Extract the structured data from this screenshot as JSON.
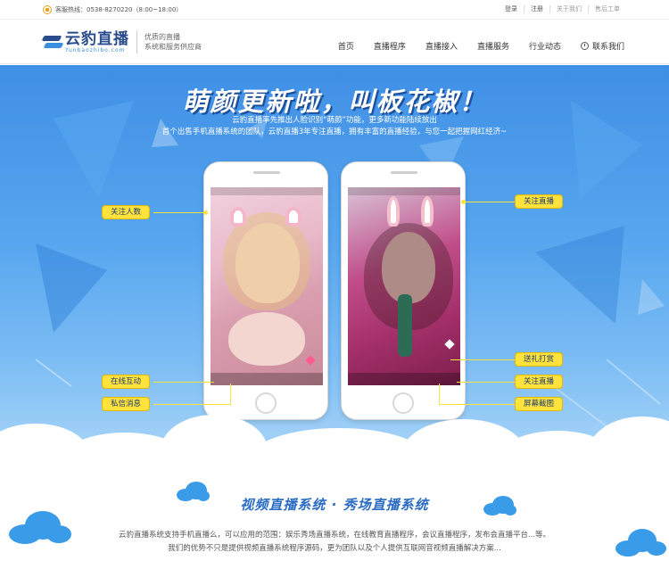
{
  "topbar": {
    "hotline": "客服热线：0538-8270220（8:00~18:00）",
    "links": [
      "登录",
      "注册",
      "关于我们",
      "售后工单"
    ]
  },
  "header": {
    "logo_cn": "云豹直播",
    "logo_en": "Yunbaozhibo.com",
    "slogan_line1": "优质的直播",
    "slogan_line2": "系统和服务供应商",
    "nav": [
      "首页",
      "直播程序",
      "直播接入",
      "直播服务",
      "行业动态"
    ],
    "contact": "联系我们"
  },
  "hero": {
    "headline": "萌颜更新啦，叫板花椒！",
    "intro_line1": "云豹直播率先推出人脸识别“萌颜”功能，更多新功能陆续放出",
    "intro_line2": "首个出售手机直播系统的团队，云豹直播3年专注直播，拥有丰富的直播经验，与您一起把握网红经济~",
    "callouts_left": [
      "关注人数",
      "在线互动",
      "私信消息"
    ],
    "callouts_right": [
      "关注直播",
      "送礼打赏",
      "关注直播",
      "屏幕截图"
    ]
  },
  "section": {
    "title": "视频直播系统 · 秀场直播系统",
    "body_line1": "云豹直播系统支持手机直播么，可以应用的范围：娱乐秀场直播系统，在线教育直播程序，会议直播程序，发布会直播平台...等。",
    "body_line2": "我们的优势不只是提供视频直播系统程序源码，更为团队以及个人提供互联网音视频直播解决方案..."
  },
  "colors": {
    "brand_blue": "#2a4c8c",
    "accent_blue": "#3c8fe0",
    "callout_yellow": "#ffe23b"
  }
}
